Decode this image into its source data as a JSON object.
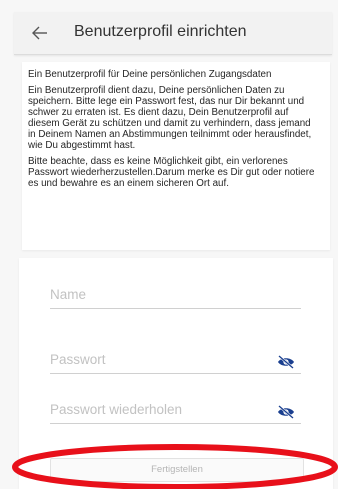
{
  "header": {
    "title": "Benutzerprofil einrichten",
    "back_icon": "arrow-left-icon"
  },
  "info": {
    "heading": "Ein Benutzerprofil für Deine persönlichen Zugangsdaten",
    "paragraph1": "Ein Benutzerprofil dient dazu, Deine persönlichen Daten zu speichern. Bitte lege ein Passwort fest, das nur Dir bekannt und schwer zu erraten ist. Es dient dazu, Dein Benutzerprofil auf diesem Gerät zu schützen und damit zu verhindern, dass jemand in Deinem Namen an Abstimmungen teilnimmt oder herausfindet, wie Du abgestimmt hast.",
    "paragraph2": "Bitte beachte, dass es keine Möglichkeit gibt, ein verlorenes Passwort wiederherzustellen.Darum merke es Dir gut oder notiere es und bewahre es an einem sicheren Ort auf."
  },
  "form": {
    "name_label": "Name",
    "password_label": "Passwort",
    "password_repeat_label": "Passwort wiederholen",
    "visibility_icon": "eye-off-icon",
    "submit_label": "Fertigstellen"
  },
  "colors": {
    "accent": "#1a3f8f",
    "annotation": "#e8101a",
    "background": "#f7f7f7"
  }
}
